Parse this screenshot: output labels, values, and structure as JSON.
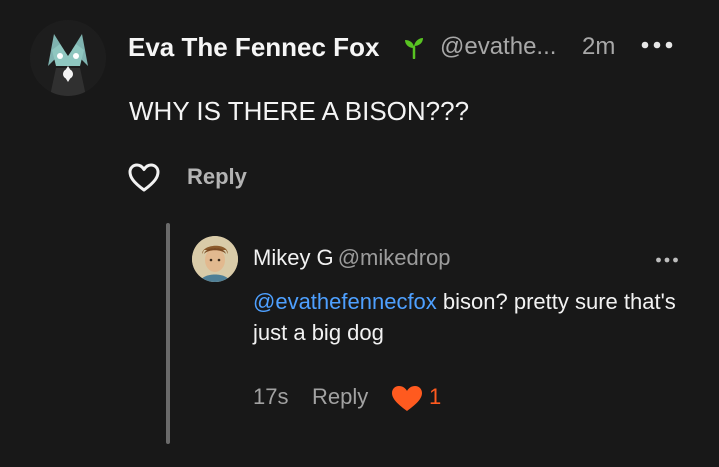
{
  "comment": {
    "author_name": "Eva The Fennec Fox",
    "handle": "@evathe...",
    "time": "2m",
    "text": "WHY IS THERE A BISON???",
    "reply_label": "Reply"
  },
  "reply": {
    "author_name": "Mikey G",
    "handle": "@mikedrop",
    "mention": "@evathefennecfox",
    "text": " bison? pretty sure that's just a big dog",
    "time": "17s",
    "reply_label": "Reply",
    "likes": "1",
    "liked": true
  },
  "colors": {
    "background": "#181818",
    "mention": "#4ea0ff",
    "like_accent": "#ff5a1f",
    "badge_green": "#58c322"
  },
  "icons": [
    "sprout-icon",
    "more-horizontal-icon",
    "heart-outline-icon",
    "heart-filled-icon"
  ]
}
